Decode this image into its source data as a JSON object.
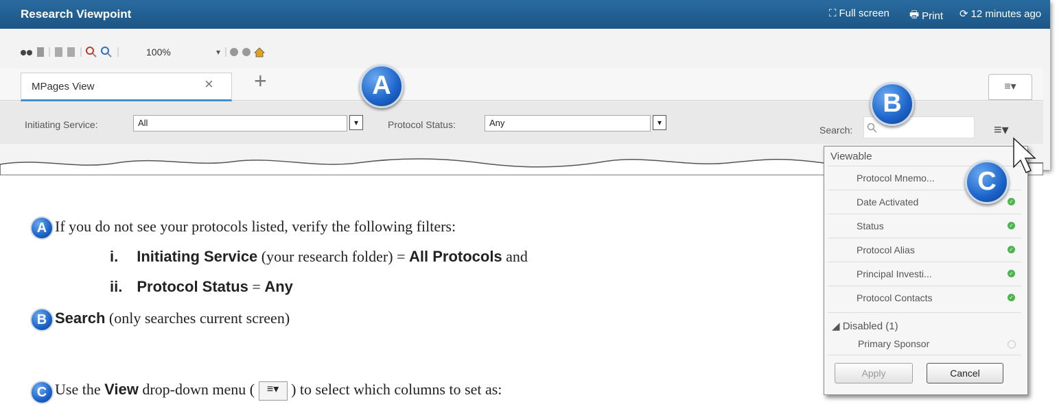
{
  "window": {
    "title": "Research Viewpoint",
    "actions": {
      "fullscreen": "Full screen",
      "print": "Print",
      "refresh": "12 minutes ago"
    }
  },
  "toolbar": {
    "zoom": "100%"
  },
  "tabs": [
    {
      "label": "MPages View"
    }
  ],
  "tab_add": "+",
  "filters": {
    "initiating_service_label": "Initiating Service:",
    "initiating_service_value": "All",
    "protocol_status_label": "Protocol Status:",
    "protocol_status_value": "Any",
    "search_label": "Search:"
  },
  "view_menu": {
    "viewable_header": "Viewable",
    "viewable_items": [
      "Protocol Mnemo...",
      "Date Activated",
      "Status",
      "Protocol Alias",
      "Principal Investi...",
      "Protocol Contacts"
    ],
    "disabled_header": "Disabled (1)",
    "disabled_items": [
      "Primary Sponsor"
    ],
    "apply_label": "Apply",
    "cancel_label": "Cancel"
  },
  "callouts": {
    "a": "A",
    "b": "B",
    "c": "C"
  },
  "instructions": {
    "a_text": "If you do not see your protocols listed, verify the following filters:",
    "i_num": "i.",
    "i_bold1": "Initiating Service",
    "i_text1": "(your research folder) =",
    "i_bold2": "All Protocols",
    "i_text2": "and",
    "ii_num": "ii.",
    "ii_bold1": "Protocol Status",
    "ii_text1": "=",
    "ii_bold2": "Any",
    "b_bold": "Search",
    "b_text": "(only searches current screen)",
    "c_text1": "Use the",
    "c_bold": "View",
    "c_text2": "drop-down menu (",
    "c_text3": ") to select which columns to set as:"
  },
  "colors": {
    "titlebar": "#1f5b8f",
    "accent": "#3f8fd3",
    "check": "#4bb54b"
  }
}
